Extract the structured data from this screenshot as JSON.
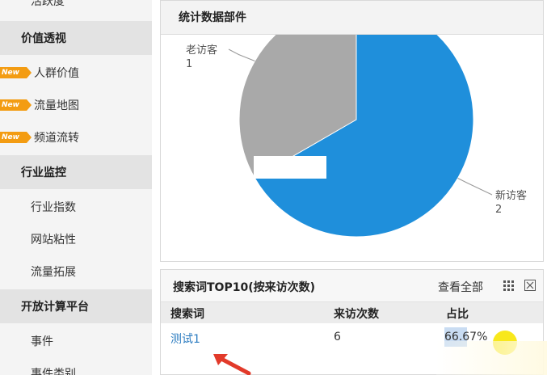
{
  "sidebar": {
    "items": [
      {
        "kind": "item",
        "label": "活跃度"
      },
      {
        "kind": "category",
        "label": "价值透视"
      },
      {
        "kind": "new",
        "label": "人群价值"
      },
      {
        "kind": "new",
        "label": "流量地图"
      },
      {
        "kind": "new",
        "label": "频道流转"
      },
      {
        "kind": "category",
        "label": "行业监控"
      },
      {
        "kind": "item",
        "label": "行业指数"
      },
      {
        "kind": "item",
        "label": "网站粘性"
      },
      {
        "kind": "item",
        "label": "流量拓展"
      },
      {
        "kind": "category",
        "label": "开放计算平台"
      },
      {
        "kind": "item",
        "label": "事件"
      },
      {
        "kind": "item",
        "label": "事件类别"
      }
    ],
    "new_badge": "New"
  },
  "stats_panel": {
    "title": "统计数据部件"
  },
  "chart_data": {
    "type": "pie",
    "slices": [
      {
        "label": "老访客",
        "value": 1,
        "color": "#a9a9a9"
      },
      {
        "label": "新访客",
        "value": 2,
        "color": "#1f8fdb"
      }
    ]
  },
  "search_panel": {
    "title": "搜索词TOP10(按来访次数)",
    "view_all": "查看全部",
    "columns": [
      "搜索词",
      "来访次数",
      "占比"
    ],
    "rows": [
      {
        "keyword": "测试1",
        "visits": "6",
        "ratio": "66.67%",
        "ratio_value": 66.67
      }
    ]
  },
  "colors": {
    "accent_blue": "#1f8fdb",
    "badge_orange": "#f39c12",
    "link_blue": "#2a7bc0"
  }
}
